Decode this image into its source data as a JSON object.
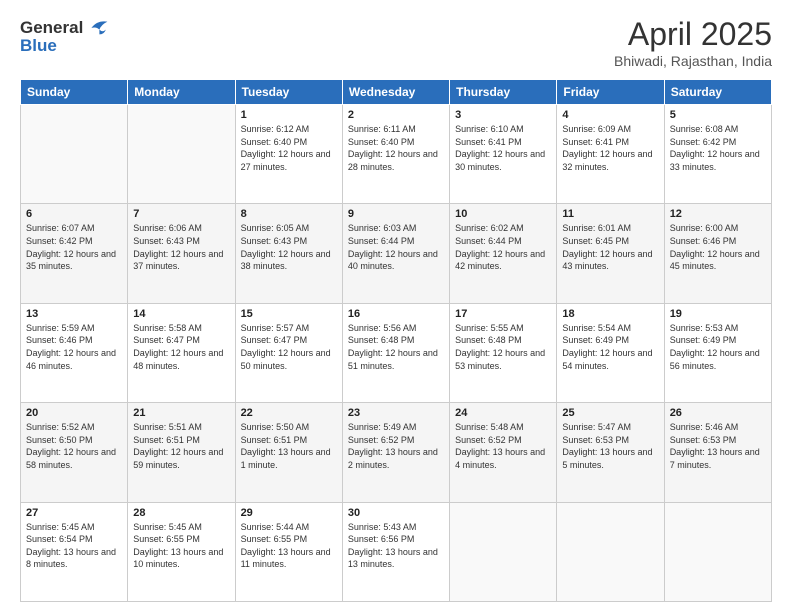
{
  "header": {
    "logo": {
      "line1": "General",
      "line2": "Blue"
    },
    "title": "April 2025",
    "location": "Bhiwadi, Rajasthan, India"
  },
  "weekdays": [
    "Sunday",
    "Monday",
    "Tuesday",
    "Wednesday",
    "Thursday",
    "Friday",
    "Saturday"
  ],
  "weeks": [
    [
      {
        "day": "",
        "info": ""
      },
      {
        "day": "",
        "info": ""
      },
      {
        "day": "1",
        "sunrise": "Sunrise: 6:12 AM",
        "sunset": "Sunset: 6:40 PM",
        "daylight": "Daylight: 12 hours and 27 minutes."
      },
      {
        "day": "2",
        "sunrise": "Sunrise: 6:11 AM",
        "sunset": "Sunset: 6:40 PM",
        "daylight": "Daylight: 12 hours and 28 minutes."
      },
      {
        "day": "3",
        "sunrise": "Sunrise: 6:10 AM",
        "sunset": "Sunset: 6:41 PM",
        "daylight": "Daylight: 12 hours and 30 minutes."
      },
      {
        "day": "4",
        "sunrise": "Sunrise: 6:09 AM",
        "sunset": "Sunset: 6:41 PM",
        "daylight": "Daylight: 12 hours and 32 minutes."
      },
      {
        "day": "5",
        "sunrise": "Sunrise: 6:08 AM",
        "sunset": "Sunset: 6:42 PM",
        "daylight": "Daylight: 12 hours and 33 minutes."
      }
    ],
    [
      {
        "day": "6",
        "sunrise": "Sunrise: 6:07 AM",
        "sunset": "Sunset: 6:42 PM",
        "daylight": "Daylight: 12 hours and 35 minutes."
      },
      {
        "day": "7",
        "sunrise": "Sunrise: 6:06 AM",
        "sunset": "Sunset: 6:43 PM",
        "daylight": "Daylight: 12 hours and 37 minutes."
      },
      {
        "day": "8",
        "sunrise": "Sunrise: 6:05 AM",
        "sunset": "Sunset: 6:43 PM",
        "daylight": "Daylight: 12 hours and 38 minutes."
      },
      {
        "day": "9",
        "sunrise": "Sunrise: 6:03 AM",
        "sunset": "Sunset: 6:44 PM",
        "daylight": "Daylight: 12 hours and 40 minutes."
      },
      {
        "day": "10",
        "sunrise": "Sunrise: 6:02 AM",
        "sunset": "Sunset: 6:44 PM",
        "daylight": "Daylight: 12 hours and 42 minutes."
      },
      {
        "day": "11",
        "sunrise": "Sunrise: 6:01 AM",
        "sunset": "Sunset: 6:45 PM",
        "daylight": "Daylight: 12 hours and 43 minutes."
      },
      {
        "day": "12",
        "sunrise": "Sunrise: 6:00 AM",
        "sunset": "Sunset: 6:46 PM",
        "daylight": "Daylight: 12 hours and 45 minutes."
      }
    ],
    [
      {
        "day": "13",
        "sunrise": "Sunrise: 5:59 AM",
        "sunset": "Sunset: 6:46 PM",
        "daylight": "Daylight: 12 hours and 46 minutes."
      },
      {
        "day": "14",
        "sunrise": "Sunrise: 5:58 AM",
        "sunset": "Sunset: 6:47 PM",
        "daylight": "Daylight: 12 hours and 48 minutes."
      },
      {
        "day": "15",
        "sunrise": "Sunrise: 5:57 AM",
        "sunset": "Sunset: 6:47 PM",
        "daylight": "Daylight: 12 hours and 50 minutes."
      },
      {
        "day": "16",
        "sunrise": "Sunrise: 5:56 AM",
        "sunset": "Sunset: 6:48 PM",
        "daylight": "Daylight: 12 hours and 51 minutes."
      },
      {
        "day": "17",
        "sunrise": "Sunrise: 5:55 AM",
        "sunset": "Sunset: 6:48 PM",
        "daylight": "Daylight: 12 hours and 53 minutes."
      },
      {
        "day": "18",
        "sunrise": "Sunrise: 5:54 AM",
        "sunset": "Sunset: 6:49 PM",
        "daylight": "Daylight: 12 hours and 54 minutes."
      },
      {
        "day": "19",
        "sunrise": "Sunrise: 5:53 AM",
        "sunset": "Sunset: 6:49 PM",
        "daylight": "Daylight: 12 hours and 56 minutes."
      }
    ],
    [
      {
        "day": "20",
        "sunrise": "Sunrise: 5:52 AM",
        "sunset": "Sunset: 6:50 PM",
        "daylight": "Daylight: 12 hours and 58 minutes."
      },
      {
        "day": "21",
        "sunrise": "Sunrise: 5:51 AM",
        "sunset": "Sunset: 6:51 PM",
        "daylight": "Daylight: 12 hours and 59 minutes."
      },
      {
        "day": "22",
        "sunrise": "Sunrise: 5:50 AM",
        "sunset": "Sunset: 6:51 PM",
        "daylight": "Daylight: 13 hours and 1 minute."
      },
      {
        "day": "23",
        "sunrise": "Sunrise: 5:49 AM",
        "sunset": "Sunset: 6:52 PM",
        "daylight": "Daylight: 13 hours and 2 minutes."
      },
      {
        "day": "24",
        "sunrise": "Sunrise: 5:48 AM",
        "sunset": "Sunset: 6:52 PM",
        "daylight": "Daylight: 13 hours and 4 minutes."
      },
      {
        "day": "25",
        "sunrise": "Sunrise: 5:47 AM",
        "sunset": "Sunset: 6:53 PM",
        "daylight": "Daylight: 13 hours and 5 minutes."
      },
      {
        "day": "26",
        "sunrise": "Sunrise: 5:46 AM",
        "sunset": "Sunset: 6:53 PM",
        "daylight": "Daylight: 13 hours and 7 minutes."
      }
    ],
    [
      {
        "day": "27",
        "sunrise": "Sunrise: 5:45 AM",
        "sunset": "Sunset: 6:54 PM",
        "daylight": "Daylight: 13 hours and 8 minutes."
      },
      {
        "day": "28",
        "sunrise": "Sunrise: 5:45 AM",
        "sunset": "Sunset: 6:55 PM",
        "daylight": "Daylight: 13 hours and 10 minutes."
      },
      {
        "day": "29",
        "sunrise": "Sunrise: 5:44 AM",
        "sunset": "Sunset: 6:55 PM",
        "daylight": "Daylight: 13 hours and 11 minutes."
      },
      {
        "day": "30",
        "sunrise": "Sunrise: 5:43 AM",
        "sunset": "Sunset: 6:56 PM",
        "daylight": "Daylight: 13 hours and 13 minutes."
      },
      {
        "day": "",
        "info": ""
      },
      {
        "day": "",
        "info": ""
      },
      {
        "day": "",
        "info": ""
      }
    ]
  ]
}
